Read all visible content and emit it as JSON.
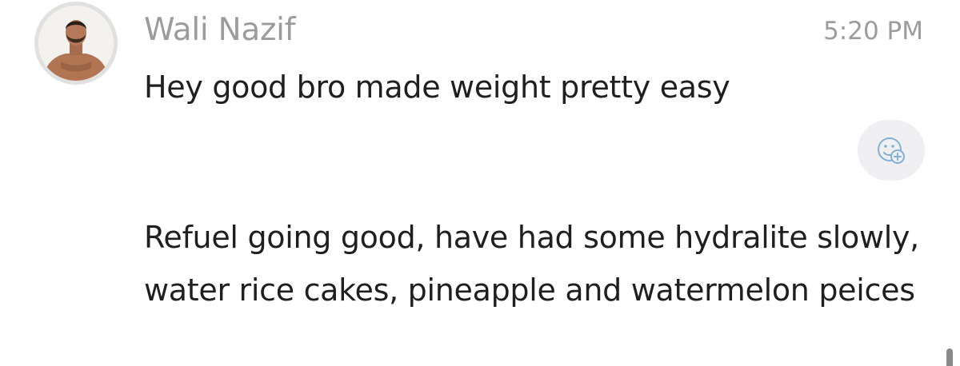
{
  "message": {
    "sender": "Wali Nazif",
    "time": "5:20 PM",
    "avatar_icon": "user-avatar-photo",
    "lines": [
      "Hey good bro made weight pretty easy",
      "Refuel going good, have had some hydralite slowly, water rice cakes, pineapple and watermelon peices"
    ]
  },
  "reaction_button": {
    "icon": "add-reaction-icon"
  },
  "colors": {
    "name": "#9c9c9c",
    "time": "#9c9c9c",
    "text": "#1f1f1f",
    "reaction_bg": "#f0f0f2",
    "reaction_icon": "#7fb2d6"
  }
}
